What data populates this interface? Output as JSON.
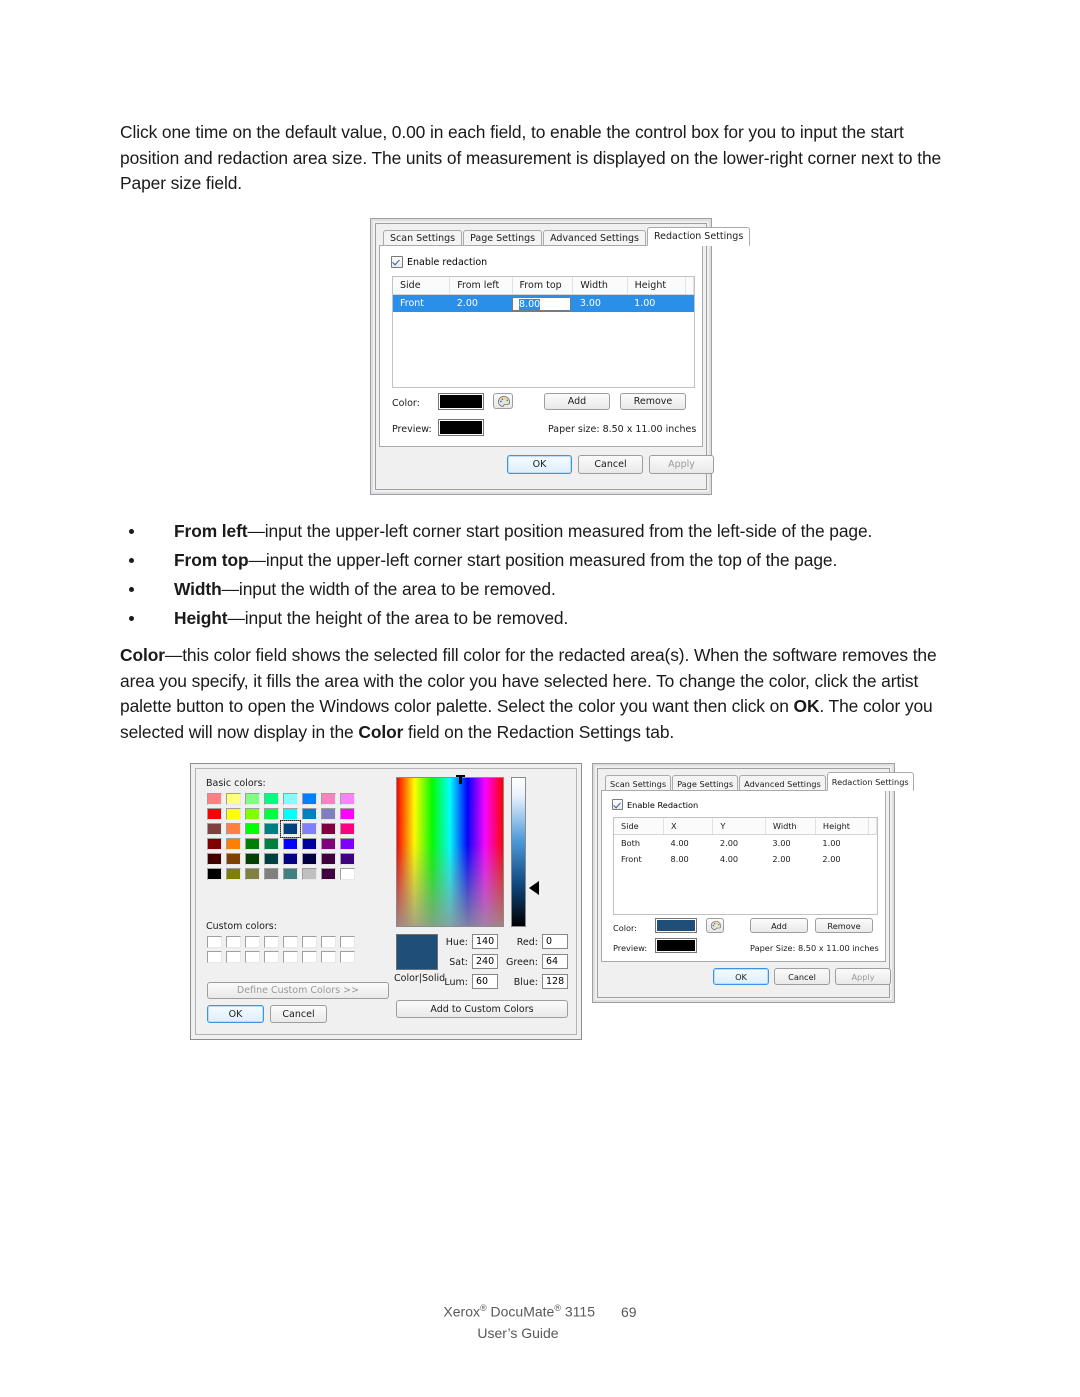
{
  "document": {
    "intro_paragraph": "Click one time on the default value, 0.00 in each field, to enable the control box for you to input the start position and redaction area size. The units of measurement is displayed on the lower-right corner next to the Paper size field.",
    "bullets": [
      {
        "term": "From left",
        "text": "—input the upper-left corner start position measured from the left-side of the page."
      },
      {
        "term": "From top",
        "text": "—input the upper-left corner start position measured from the top of the page."
      },
      {
        "term": "Width",
        "text": "—input the width of the area to be removed."
      },
      {
        "term": "Height",
        "text": "—input the height of the area to be removed."
      }
    ],
    "color_paragraph": {
      "term": "Color",
      "part1": "—this color field shows the selected fill color for the redacted area(s). When the software removes the area you specify, it fills the area with the color you have selected here. To change the color, click the artist palette button to open the Windows color palette. Select the color you want then click on ",
      "ok": "OK",
      "part2": ". The color you selected will now display in the ",
      "color_bold": "Color",
      "part3": " field on the Redaction Settings tab."
    },
    "footer": {
      "brand": "Xerox",
      "product": " DocuMate",
      "model": " 3115",
      "page_number": "69",
      "guide": "User’s Guide",
      "registered_mark": "®"
    }
  },
  "dialog1": {
    "tabs": [
      {
        "label": "Scan Settings",
        "active": false
      },
      {
        "label": "Page Settings",
        "active": false
      },
      {
        "label": "Advanced Settings",
        "active": false
      },
      {
        "label": "Redaction Settings",
        "active": true
      }
    ],
    "enable_checkbox_label": "Enable redaction",
    "grid": {
      "headers": [
        "Side",
        "From left",
        "From top",
        "Width",
        "Height"
      ],
      "rows": [
        {
          "selected": true,
          "cells": [
            "Front",
            "2.00",
            "8.00",
            "3.00",
            "1.00"
          ],
          "editing_column_index": 2
        }
      ]
    },
    "color_label": "Color:",
    "color_value": "#000000",
    "preview_label": "Preview:",
    "preview_value": "#000000",
    "add_button": "Add",
    "remove_button": "Remove",
    "paper_size_text": "Paper size:  8.50 x 11.00 inches",
    "ok_button": "OK",
    "cancel_button": "Cancel",
    "apply_button": "Apply"
  },
  "dialog2": {
    "tabs": [
      {
        "label": "Scan Settings",
        "active": false
      },
      {
        "label": "Page Settings",
        "active": false
      },
      {
        "label": "Advanced Settings",
        "active": false
      },
      {
        "label": "Redaction Settings",
        "active": true
      }
    ],
    "enable_checkbox_label": "Enable Redaction",
    "grid": {
      "headers": [
        "Side",
        "X",
        "Y",
        "Width",
        "Height"
      ],
      "rows": [
        {
          "selected": false,
          "cells": [
            "Both",
            "4.00",
            "2.00",
            "3.00",
            "1.00"
          ]
        },
        {
          "selected": false,
          "cells": [
            "Front",
            "8.00",
            "4.00",
            "2.00",
            "2.00"
          ]
        }
      ]
    },
    "color_label": "Color:",
    "color_value": "#1f4e79",
    "preview_label": "Preview:",
    "preview_value": "#000000",
    "add_button": "Add",
    "remove_button": "Remove",
    "paper_size_text": "Paper Size:  8.50 x 11.00 inches",
    "ok_button": "OK",
    "cancel_button": "Cancel",
    "apply_button": "Apply"
  },
  "color_picker": {
    "basic_colors_label": "Basic colors:",
    "custom_colors_label": "Custom colors:",
    "basic_colors": [
      "#FF8080",
      "#FFFF80",
      "#80FF80",
      "#00FF80",
      "#80FFFF",
      "#0080FF",
      "#FF80C0",
      "#FF80FF",
      "#FF0000",
      "#FFFF00",
      "#80FF00",
      "#00FF40",
      "#00FFFF",
      "#0080C0",
      "#8080C0",
      "#FF00FF",
      "#804040",
      "#FF8040",
      "#00FF00",
      "#008080",
      "#004080",
      "#8080FF",
      "#800040",
      "#FF0080",
      "#800000",
      "#FF8000",
      "#008000",
      "#008040",
      "#0000FF",
      "#0000A0",
      "#800080",
      "#8000FF",
      "#400000",
      "#804000",
      "#004000",
      "#004040",
      "#000080",
      "#000040",
      "#400040",
      "#400080",
      "#000000",
      "#808000",
      "#808040",
      "#808080",
      "#408080",
      "#C0C0C0",
      "#400040",
      "#FFFFFF"
    ],
    "selected_basic_index": 20,
    "custom_color_count": 16,
    "define_custom_button": "Define Custom Colors >>",
    "ok_button": "OK",
    "cancel_button": "Cancel",
    "color_solid_label": "Color|Solid",
    "add_to_custom_button": "Add to Custom Colors",
    "current_color": "#1f4e79",
    "fields": [
      {
        "label": "Hue:",
        "value": "140"
      },
      {
        "label": "Sat:",
        "value": "240"
      },
      {
        "label": "Lum:",
        "value": "60"
      },
      {
        "label": "Red:",
        "value": "0"
      },
      {
        "label": "Green:",
        "value": "64"
      },
      {
        "label": "Blue:",
        "value": "128"
      }
    ]
  }
}
